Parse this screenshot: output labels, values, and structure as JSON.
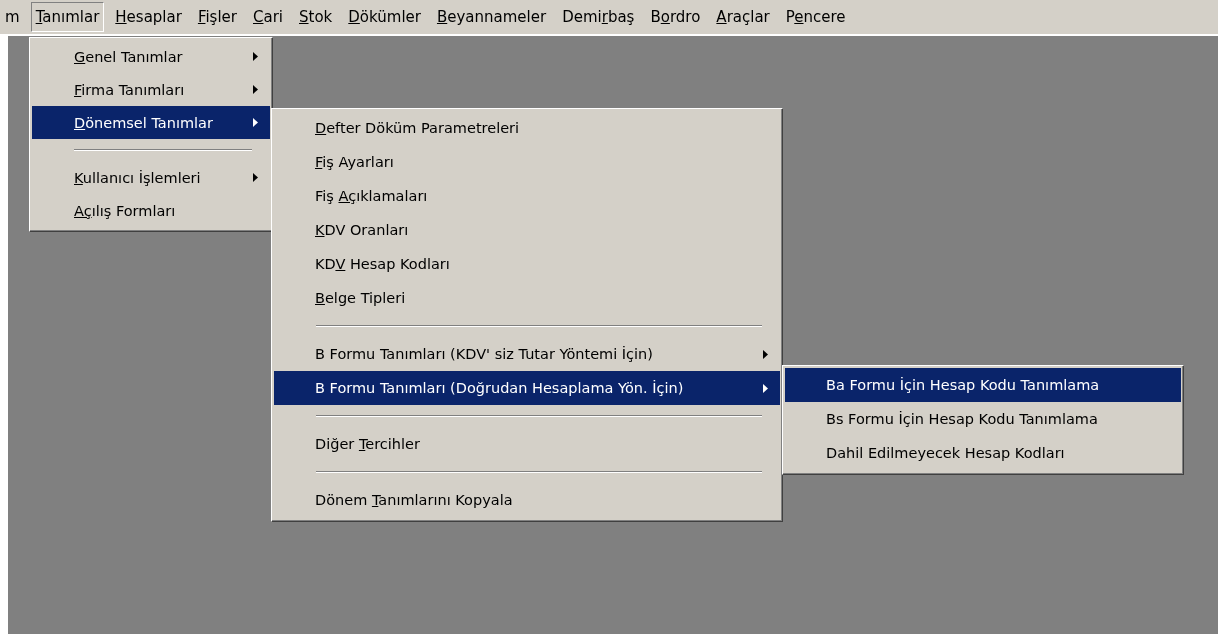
{
  "menubar": [
    {
      "parts": [
        {
          "text": "m",
          "underlined": false
        }
      ],
      "selected": false
    },
    {
      "parts": [
        {
          "text": "T",
          "underlined": true
        },
        {
          "text": "anımlar",
          "underlined": false
        }
      ],
      "selected": true
    },
    {
      "parts": [
        {
          "text": "H",
          "underlined": true
        },
        {
          "text": "esaplar",
          "underlined": false
        }
      ],
      "selected": false
    },
    {
      "parts": [
        {
          "text": "F",
          "underlined": true
        },
        {
          "text": "işler",
          "underlined": false
        }
      ],
      "selected": false
    },
    {
      "parts": [
        {
          "text": "C",
          "underlined": true
        },
        {
          "text": "ari",
          "underlined": false
        }
      ],
      "selected": false
    },
    {
      "parts": [
        {
          "text": "S",
          "underlined": true
        },
        {
          "text": "tok",
          "underlined": false
        }
      ],
      "selected": false
    },
    {
      "parts": [
        {
          "text": "D",
          "underlined": true
        },
        {
          "text": "ökümler",
          "underlined": false
        }
      ],
      "selected": false
    },
    {
      "parts": [
        {
          "text": "B",
          "underlined": true
        },
        {
          "text": "eyannameler",
          "underlined": false
        }
      ],
      "selected": false
    },
    {
      "parts": [
        {
          "text": "Demi",
          "underlined": false
        },
        {
          "text": "r",
          "underlined": true
        },
        {
          "text": "baş",
          "underlined": false
        }
      ],
      "selected": false
    },
    {
      "parts": [
        {
          "text": "B",
          "underlined": false
        },
        {
          "text": "o",
          "underlined": true
        },
        {
          "text": "rdro",
          "underlined": false
        }
      ],
      "selected": false
    },
    {
      "parts": [
        {
          "text": "A",
          "underlined": true
        },
        {
          "text": "raçlar",
          "underlined": false
        }
      ],
      "selected": false
    },
    {
      "parts": [
        {
          "text": "P",
          "underlined": false
        },
        {
          "text": "e",
          "underlined": true
        },
        {
          "text": "ncere",
          "underlined": false
        }
      ],
      "selected": false
    }
  ],
  "menus": [
    {
      "items": [
        {
          "kind": "item",
          "parts": [
            {
              "text": "G",
              "underlined": true
            },
            {
              "text": "enel Tanımlar",
              "underlined": false
            }
          ],
          "has_submenu": true,
          "selected": false
        },
        {
          "kind": "item",
          "parts": [
            {
              "text": "F",
              "underlined": true
            },
            {
              "text": "irma Tanımları",
              "underlined": false
            }
          ],
          "has_submenu": true,
          "selected": false
        },
        {
          "kind": "item",
          "parts": [
            {
              "text": "D",
              "underlined": true
            },
            {
              "text": "önemsel Tanımlar",
              "underlined": false
            }
          ],
          "has_submenu": true,
          "selected": true
        },
        {
          "kind": "separator"
        },
        {
          "kind": "item",
          "parts": [
            {
              "text": "K",
              "underlined": true
            },
            {
              "text": "ullanıcı İşlemleri",
              "underlined": false
            }
          ],
          "has_submenu": true,
          "selected": false
        },
        {
          "kind": "item",
          "parts": [
            {
              "text": "Aç",
              "underlined": true
            },
            {
              "text": "ılış Formları",
              "underlined": false
            }
          ],
          "has_submenu": false,
          "selected": false
        }
      ]
    },
    {
      "items": [
        {
          "kind": "item",
          "parts": [
            {
              "text": "D",
              "underlined": true
            },
            {
              "text": "efter Döküm Parametreleri",
              "underlined": false
            }
          ],
          "has_submenu": false,
          "selected": false
        },
        {
          "kind": "item",
          "parts": [
            {
              "text": "F",
              "underlined": true
            },
            {
              "text": "iş Ayarları",
              "underlined": false
            }
          ],
          "has_submenu": false,
          "selected": false
        },
        {
          "kind": "item",
          "parts": [
            {
              "text": "Fiş ",
              "underlined": false
            },
            {
              "text": "Aç",
              "underlined": true
            },
            {
              "text": "ıklamaları",
              "underlined": false
            }
          ],
          "has_submenu": false,
          "selected": false
        },
        {
          "kind": "item",
          "parts": [
            {
              "text": "K",
              "underlined": true
            },
            {
              "text": "DV Oranları",
              "underlined": false
            }
          ],
          "has_submenu": false,
          "selected": false
        },
        {
          "kind": "item",
          "parts": [
            {
              "text": "KD",
              "underlined": false
            },
            {
              "text": "V",
              "underlined": true
            },
            {
              "text": " Hesap Kodları",
              "underlined": false
            }
          ],
          "has_submenu": false,
          "selected": false
        },
        {
          "kind": "item",
          "parts": [
            {
              "text": "B",
              "underlined": true
            },
            {
              "text": "elge Tipleri",
              "underlined": false
            }
          ],
          "has_submenu": false,
          "selected": false
        },
        {
          "kind": "separator"
        },
        {
          "kind": "item",
          "parts": [
            {
              "text": "B Formu Tanımları (KDV' siz Tutar Yöntemi  İçin)",
              "underlined": false
            }
          ],
          "has_submenu": true,
          "selected": false
        },
        {
          "kind": "item",
          "parts": [
            {
              "text": "B Formu Tanımları (Doğrudan Hesaplama Yön. İçin)",
              "underlined": false
            }
          ],
          "has_submenu": true,
          "selected": true
        },
        {
          "kind": "separator"
        },
        {
          "kind": "item",
          "parts": [
            {
              "text": "Diğer ",
              "underlined": false
            },
            {
              "text": "T",
              "underlined": true
            },
            {
              "text": "ercihler",
              "underlined": false
            }
          ],
          "has_submenu": false,
          "selected": false
        },
        {
          "kind": "separator"
        },
        {
          "kind": "item",
          "parts": [
            {
              "text": "Dönem ",
              "underlined": false
            },
            {
              "text": "T",
              "underlined": true
            },
            {
              "text": "anımlarını Kopyala",
              "underlined": false
            }
          ],
          "has_submenu": false,
          "selected": false
        }
      ]
    },
    {
      "items": [
        {
          "kind": "item",
          "parts": [
            {
              "text": "Ba Formu İçin Hesap Kodu Tanımlama",
              "underlined": false
            }
          ],
          "has_submenu": false,
          "selected": true
        },
        {
          "kind": "item",
          "parts": [
            {
              "text": "Bs Formu İçin Hesap Kodu Tanımlama",
              "underlined": false
            }
          ],
          "has_submenu": false,
          "selected": false
        },
        {
          "kind": "item",
          "parts": [
            {
              "text": "Dahil Edilmeyecek Hesap Kodları",
              "underlined": false
            }
          ],
          "has_submenu": false,
          "selected": false
        }
      ]
    }
  ]
}
